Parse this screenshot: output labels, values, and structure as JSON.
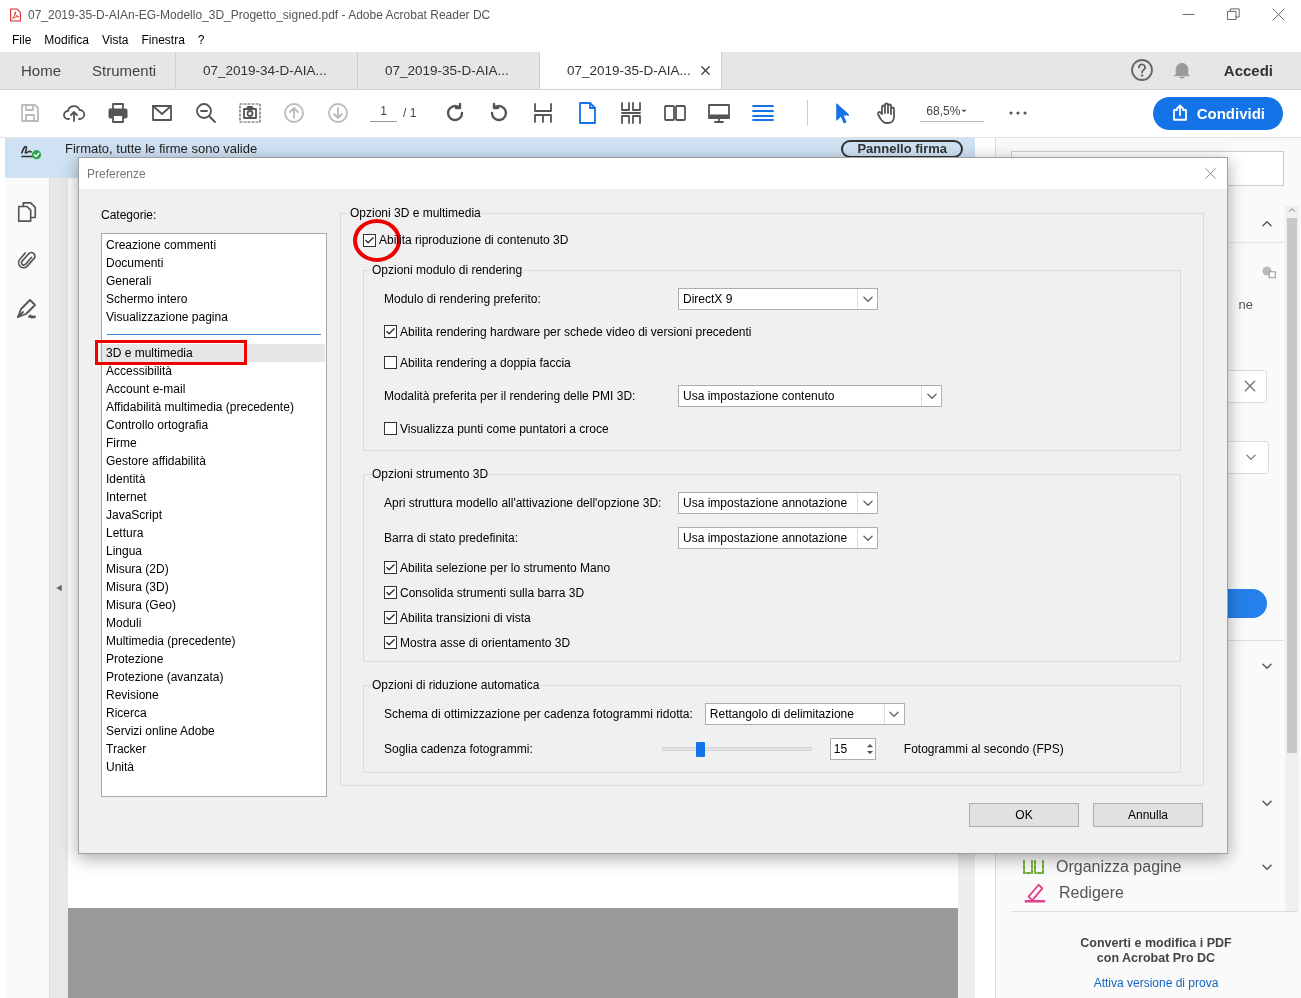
{
  "window": {
    "title": "07_2019-35-D-AIAn-EG-Modello_3D_Progetto_signed.pdf - Adobe Acrobat Reader DC"
  },
  "menu": [
    "File",
    "Modifica",
    "Vista",
    "Finestra",
    "?"
  ],
  "nav": {
    "items": [
      "Home",
      "Strumenti"
    ],
    "tabs": [
      {
        "label": "07_2019-34-D-AIA...",
        "selected": false
      },
      {
        "label": "07_2019-35-D-AIA...",
        "selected": false
      },
      {
        "label": "07_2019-35-D-AIA...",
        "selected": true
      }
    ],
    "sign_in": "Accedi"
  },
  "toolbar": {
    "page": "1",
    "page_total": "/ 1",
    "zoom": "68,5%",
    "share": "Condividi"
  },
  "signature_bar": {
    "message": "Firmato, tutte le firme sono valide",
    "button": "Pannello firma"
  },
  "right_panel": {
    "fragment": "ne",
    "tools": [
      "Organizza pagine",
      "Redigere"
    ],
    "promo": "Converti e modifica i PDF con Acrobat Pro DC",
    "promo_link": "Attiva versione di prova"
  },
  "dialog": {
    "title": "Preferenze",
    "categories_label": "Categorie:",
    "category_groups": [
      {
        "items": [
          {
            "label": "Creazione commenti",
            "selected": false,
            "highlighted": false
          },
          {
            "label": "Documenti",
            "selected": false,
            "highlighted": false
          },
          {
            "label": "Generali",
            "selected": false,
            "highlighted": false
          },
          {
            "label": "Schermo intero",
            "selected": false,
            "highlighted": false
          },
          {
            "label": "Visualizzazione pagina",
            "selected": false,
            "highlighted": false
          }
        ]
      },
      {
        "items": [
          {
            "label": "3D e multimedia",
            "selected": true,
            "highlighted": true
          },
          {
            "label": "Accessibilità",
            "selected": false,
            "highlighted": false
          },
          {
            "label": "Account e-mail",
            "selected": false,
            "highlighted": false
          },
          {
            "label": "Affidabilità multimedia (precedente)",
            "selected": false,
            "highlighted": false
          },
          {
            "label": "Controllo ortografia",
            "selected": false,
            "highlighted": false
          },
          {
            "label": "Firme",
            "selected": false,
            "highlighted": false
          },
          {
            "label": "Gestore affidabilità",
            "selected": false,
            "highlighted": false
          },
          {
            "label": "Identità",
            "selected": false,
            "highlighted": false
          },
          {
            "label": "Internet",
            "selected": false,
            "highlighted": false
          },
          {
            "label": "JavaScript",
            "selected": false,
            "highlighted": false
          },
          {
            "label": "Lettura",
            "selected": false,
            "highlighted": false
          },
          {
            "label": "Lingua",
            "selected": false,
            "highlighted": false
          },
          {
            "label": "Misura (2D)",
            "selected": false,
            "highlighted": false
          },
          {
            "label": "Misura (3D)",
            "selected": false,
            "highlighted": false
          },
          {
            "label": "Misura (Geo)",
            "selected": false,
            "highlighted": false
          },
          {
            "label": "Moduli",
            "selected": false,
            "highlighted": false
          },
          {
            "label": "Multimedia (precedente)",
            "selected": false,
            "highlighted": false
          },
          {
            "label": "Protezione",
            "selected": false,
            "highlighted": false
          },
          {
            "label": "Protezione (avanzata)",
            "selected": false,
            "highlighted": false
          },
          {
            "label": "Revisione",
            "selected": false,
            "highlighted": false
          },
          {
            "label": "Ricerca",
            "selected": false,
            "highlighted": false
          },
          {
            "label": "Servizi online Adobe",
            "selected": false,
            "highlighted": false
          },
          {
            "label": "Tracker",
            "selected": false,
            "highlighted": false
          },
          {
            "label": "Unità",
            "selected": false,
            "highlighted": false
          }
        ]
      }
    ],
    "group": {
      "legend": "Opzioni 3D e multimedia",
      "enable": {
        "label": "Abilita riproduzione di contenuto 3D",
        "checked": true,
        "circled": true
      },
      "sections": [
        {
          "legend": "Opzioni modulo di rendering",
          "rows": [
            {
              "kind": "dropdown",
              "label": "Modulo di rendering preferito:",
              "value": "DirectX 9"
            },
            {
              "kind": "checkbox",
              "label": "Abilita rendering hardware per schede video di versioni precedenti",
              "checked": true
            },
            {
              "kind": "checkbox",
              "label": "Abilita rendering a doppia faccia",
              "checked": false
            },
            {
              "kind": "dropdown",
              "label": "Modalità preferita per il rendering delle PMI 3D:",
              "value": "Usa impostazione contenuto"
            },
            {
              "kind": "checkbox",
              "label": "Visualizza punti come puntatori a croce",
              "checked": false
            }
          ]
        },
        {
          "legend": "Opzioni strumento 3D",
          "rows": [
            {
              "kind": "dropdown",
              "label": "Apri struttura modello all'attivazione dell'opzione 3D:",
              "value": "Usa impostazione annotazione"
            },
            {
              "kind": "dropdown",
              "label": "Barra di stato predefinita:",
              "value": "Usa impostazione annotazione"
            },
            {
              "kind": "checkbox",
              "label": "Abilita selezione per lo strumento Mano",
              "checked": true
            },
            {
              "kind": "checkbox",
              "label": "Consolida strumenti sulla barra 3D",
              "checked": true
            },
            {
              "kind": "checkbox",
              "label": "Abilita transizioni di vista",
              "checked": true
            },
            {
              "kind": "checkbox",
              "label": "Mostra asse di orientamento 3D",
              "checked": true
            }
          ]
        },
        {
          "legend": "Opzioni di riduzione automatica",
          "rows": [
            {
              "kind": "dropdown",
              "label": "Schema di ottimizzazione per cadenza fotogrammi ridotta:",
              "value": "Rettangolo di delimitazione"
            },
            {
              "kind": "slider",
              "label": "Soglia cadenza fotogrammi:",
              "level": 0.25,
              "value": "15",
              "unit": "Fotogrammi al secondo (FPS)"
            }
          ]
        }
      ]
    },
    "buttons": [
      "OK",
      "Annulla"
    ]
  }
}
